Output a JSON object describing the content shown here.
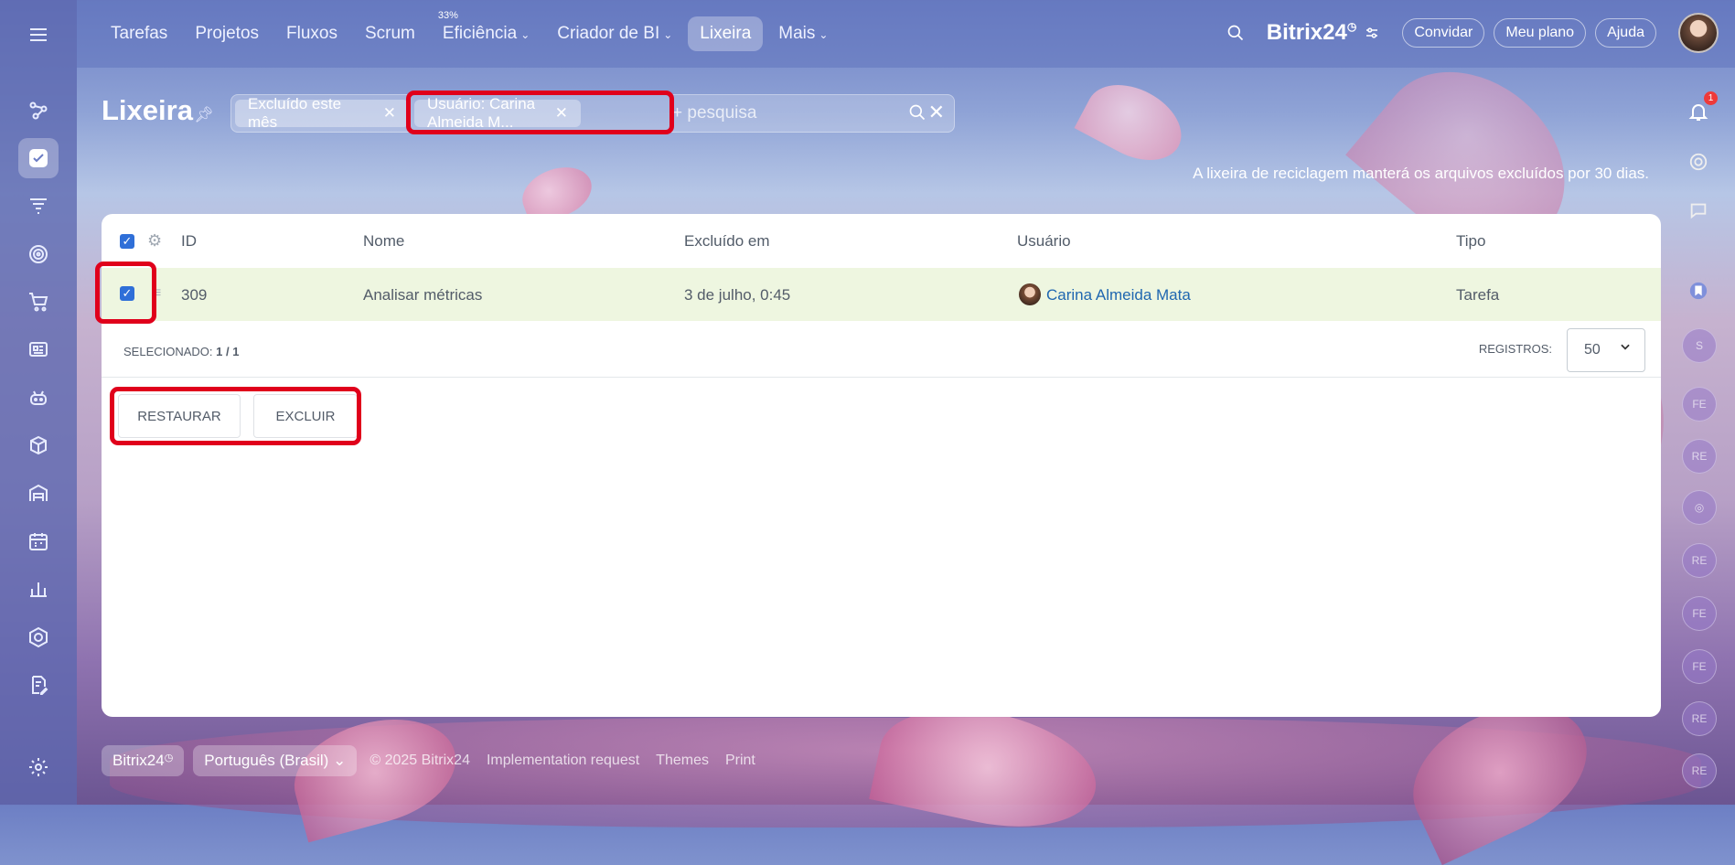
{
  "topbar": {
    "nav": [
      {
        "label": "Tarefas",
        "dropdown": false,
        "active": false
      },
      {
        "label": "Projetos",
        "dropdown": false,
        "active": false
      },
      {
        "label": "Fluxos",
        "dropdown": false,
        "active": false
      },
      {
        "label": "Scrum",
        "dropdown": false,
        "active": false
      },
      {
        "label": "Eficiência",
        "dropdown": true,
        "active": false,
        "badge": "33%"
      },
      {
        "label": "Criador de BI",
        "dropdown": true,
        "active": false
      },
      {
        "label": "Lixeira",
        "dropdown": false,
        "active": true
      },
      {
        "label": "Mais",
        "dropdown": true,
        "active": false
      }
    ],
    "brand": "Bitrix",
    "brand_num": "24",
    "brand_sup": "◷",
    "invite": "Convidar",
    "plan": "Meu plano",
    "help": "Ajuda"
  },
  "page": {
    "title": "Lixeira",
    "hint": "A lixeira de reciclagem manterá os arquivos excluídos por 30 dias."
  },
  "filter": {
    "chip1": "Excluído este mês",
    "chip2": "Usuário: Carina Almeida M...",
    "placeholder": "+ pesquisa"
  },
  "table": {
    "headers": {
      "id": "ID",
      "name": "Nome",
      "deleted": "Excluído em",
      "user": "Usuário",
      "type": "Tipo"
    },
    "rows": [
      {
        "id": "309",
        "name": "Analisar métricas",
        "deleted": "3 de julho, 0:45",
        "user": "Carina Almeida Mata",
        "type": "Tarefa",
        "checked": true
      }
    ],
    "selected_label": "SELECIONADO:",
    "selected_value": "1 / 1",
    "records_label": "REGISTROS:",
    "records_value": "50"
  },
  "actions": {
    "restore": "RESTAURAR",
    "delete": "EXCLUIR"
  },
  "rightbar": {
    "notifications": "1",
    "avatars": [
      "S",
      "FE",
      "RE",
      "RE",
      "FE",
      "FE",
      "RE",
      "RE"
    ]
  },
  "footer": {
    "brand": "Bitrix24",
    "brand_sup": "◷",
    "language": "Português (Brasil)",
    "copyright": "© 2025 Bitrix24",
    "impl": "Implementation request",
    "themes": "Themes",
    "print": "Print"
  },
  "colors": {
    "accent": "#2f6fd8",
    "highlight": "#e0001b",
    "row_selected": "#eef6e0"
  }
}
